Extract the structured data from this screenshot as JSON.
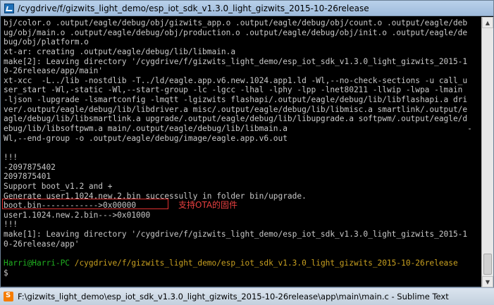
{
  "window": {
    "title": "/cygdrive/f/gizwits_light_demo/esp_iot_sdk_v1.3.0_light_gizwits_2015-10-26release"
  },
  "terminal": {
    "lines": [
      "bj/color.o .output/eagle/debug/obj/gizwits_app.o .output/eagle/debug/obj/count.o .output/eagle/deb",
      "ug/obj/main.o .output/eagle/debug/obj/production.o .output/eagle/debug/obj/init.o .output/eagle/de",
      "bug/obj/platform.o",
      "xt-ar: creating .output/eagle/debug/lib/libmain.a",
      "make[2]: Leaving directory '/cygdrive/f/gizwits_light_demo/esp_iot_sdk_v1.3.0_light_gizwits_2015-1",
      "0-26release/app/main'",
      "xt-xcc  -L../lib -nostdlib -T../ld/eagle.app.v6.new.1024.app1.ld -Wl,--no-check-sections -u call_u",
      "ser_start -Wl,-static -Wl,--start-group -lc -lgcc -lhal -lphy -lpp -lnet80211 -llwip -lwpa -lmain",
      "-ljson -lupgrade -lsmartconfig -lmqtt -lgizwits flashapi/.output/eagle/debug/lib/libflashapi.a dri",
      "ver/.output/eagle/debug/lib/libdriver.a misc/.output/eagle/debug/lib/libmisc.a smartlink/.output/e",
      "agle/debug/lib/libsmartlink.a upgrade/.output/eagle/debug/lib/libupgrade.a softpwm/.output/eagle/d",
      "ebug/lib/libsoftpwm.a main/.output/eagle/debug/lib/libmain.a                                      -",
      "Wl,--end-group -o .output/eagle/debug/image/eagle.app.v6.out",
      "",
      "!!!",
      "-2097875402",
      "2097875401",
      "Support boot_v1.2 and +",
      "Generate user1.1024.new.2.bin successully in folder bin/upgrade.",
      "boot.bin------------>0x00000",
      "user1.1024.new.2.bin--->0x01000",
      "!!!",
      "make[1]: Leaving directory '/cygdrive/f/gizwits_light_demo/esp_iot_sdk_v1.3.0_light_gizwits_2015-1",
      "0-26release/app'",
      ""
    ],
    "prompt_user": "Harri@Harri-PC",
    "prompt_path": " /cygdrive/f/gizwits_light_demo/esp_iot_sdk_v1.3.0_light_gizwits_2015-10-26release",
    "input_line": "$ "
  },
  "annotation": {
    "text": "支持OTA的固件",
    "color": "#e84040"
  },
  "taskbar": {
    "title": "F:\\gizwits_light_demo\\esp_iot_sdk_v1.3.0_light_gizwits_2015-10-26release\\app\\main\\main.c - Sublime Text"
  },
  "icons": {
    "window": "cygwin-terminal-icon",
    "taskbar": "sublime-text-icon",
    "scroll_up": "scroll-up-arrow-icon",
    "scroll_down": "scroll-down-arrow-icon"
  }
}
